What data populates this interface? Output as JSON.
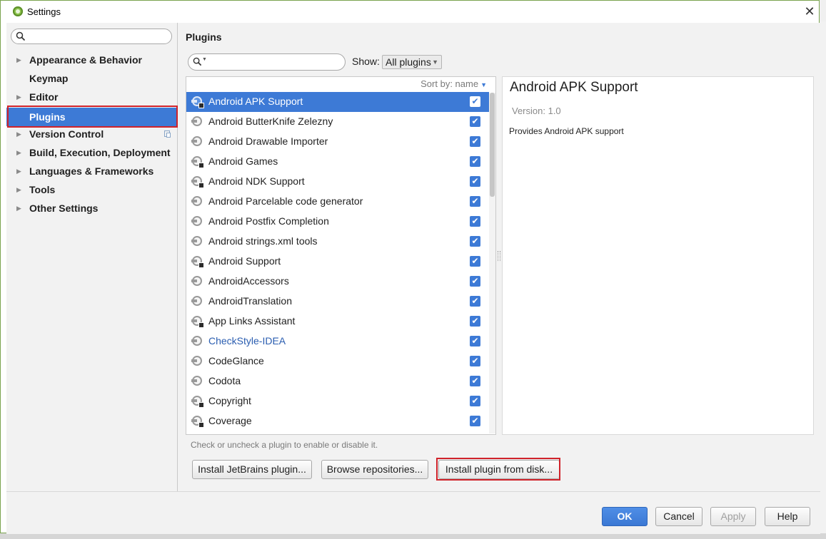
{
  "window": {
    "title": "Settings",
    "close_glyph": "✕"
  },
  "sidebar": {
    "search_placeholder": "",
    "items": [
      {
        "label": "Appearance & Behavior",
        "expandable": true
      },
      {
        "label": "Keymap",
        "expandable": false
      },
      {
        "label": "Editor",
        "expandable": true
      },
      {
        "label": "Plugins",
        "expandable": false,
        "selected": true
      },
      {
        "label": "Version Control",
        "expandable": true
      },
      {
        "label": "Build, Execution, Deployment",
        "expandable": true
      },
      {
        "label": "Languages & Frameworks",
        "expandable": true
      },
      {
        "label": "Tools",
        "expandable": true
      },
      {
        "label": "Other Settings",
        "expandable": true
      }
    ]
  },
  "plugins": {
    "heading": "Plugins",
    "search_placeholder": "",
    "show_label": "Show:",
    "show_value": "All plugins",
    "sort_label": "Sort by: name",
    "list": [
      {
        "name": "Android APK Support",
        "checked": true,
        "selected": true,
        "bundled": true
      },
      {
        "name": "Android ButterKnife Zelezny",
        "checked": true,
        "bundled": false
      },
      {
        "name": "Android Drawable Importer",
        "checked": true,
        "bundled": false
      },
      {
        "name": "Android Games",
        "checked": true,
        "bundled": true
      },
      {
        "name": "Android NDK Support",
        "checked": true,
        "bundled": true
      },
      {
        "name": "Android Parcelable code generator",
        "checked": true,
        "bundled": false
      },
      {
        "name": "Android Postfix Completion",
        "checked": true,
        "bundled": false
      },
      {
        "name": "Android strings.xml tools",
        "checked": true,
        "bundled": false
      },
      {
        "name": "Android Support",
        "checked": true,
        "bundled": true
      },
      {
        "name": "AndroidAccessors",
        "checked": true,
        "bundled": false
      },
      {
        "name": "AndroidTranslation",
        "checked": true,
        "bundled": false
      },
      {
        "name": "App Links Assistant",
        "checked": true,
        "bundled": true
      },
      {
        "name": "CheckStyle-IDEA",
        "checked": true,
        "bundled": false,
        "link": true
      },
      {
        "name": "CodeGlance",
        "checked": true,
        "bundled": false
      },
      {
        "name": "Codota",
        "checked": true,
        "bundled": false
      },
      {
        "name": "Copyright",
        "checked": true,
        "bundled": true
      },
      {
        "name": "Coverage",
        "checked": true,
        "bundled": true
      }
    ],
    "detail": {
      "title": "Android APK Support",
      "version": "Version: 1.0",
      "description": "Provides Android APK support"
    },
    "hint": "Check or uncheck a plugin to enable or disable it.",
    "buttons": {
      "install_jetbrains": "Install JetBrains plugin...",
      "browse": "Browse repositories...",
      "install_disk": "Install plugin from disk..."
    }
  },
  "footer": {
    "ok": "OK",
    "cancel": "Cancel",
    "apply": "Apply",
    "help": "Help"
  },
  "colors": {
    "accent": "#3d7ad6",
    "highlight_outline": "#d0232a",
    "link": "#2a5db0"
  },
  "icons": {
    "search": "search-icon",
    "checkbox": "checkbox-checked-icon",
    "plugin": "plugin-icon"
  }
}
